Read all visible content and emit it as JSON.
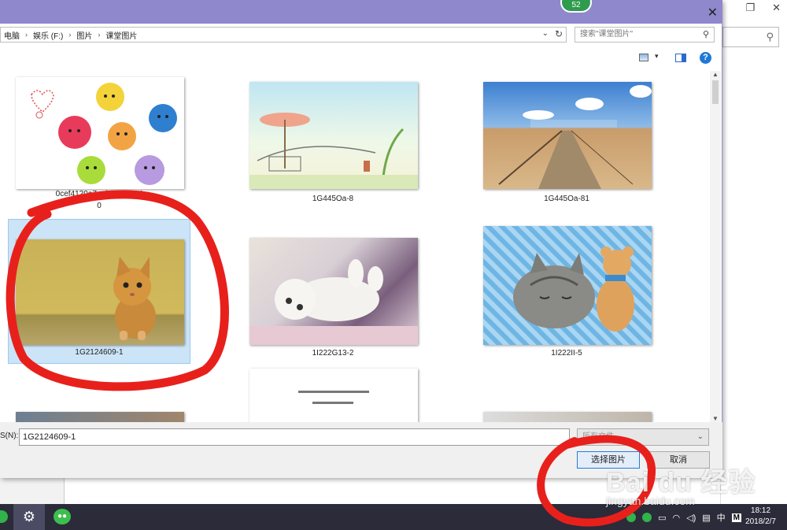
{
  "dialog": {
    "badge": "52",
    "close_glyph": "✕",
    "address": {
      "crumbs": [
        "电脑",
        "娱乐 (F:)",
        "图片",
        "课堂图片"
      ],
      "separator": "›",
      "dropdown_glyph": "⌄",
      "refresh_glyph": "↻"
    },
    "search": {
      "placeholder": "搜索\"课堂图片\"",
      "icon": "search-icon"
    },
    "help_glyph": "?",
    "view_glyph": "▾",
    "items": [
      {
        "caption": "0cef4120a7...d1_522_34",
        "caption2": "0",
        "picture": "blob-characters",
        "selected": false
      },
      {
        "caption": "1G445Oa-8",
        "picture": "garden-pavilion",
        "selected": false
      },
      {
        "caption": "1G445Oa-81",
        "picture": "beach-boardwalk",
        "selected": false
      },
      {
        "caption": "1G2124609-1",
        "picture": "orange-kitten",
        "selected": true
      },
      {
        "caption": "1I222G13-2",
        "picture": "white-kitten",
        "selected": false
      },
      {
        "caption": "1I222II-5",
        "picture": "sleeping-cat-teddy",
        "selected": false
      }
    ],
    "filename": {
      "label": "S(N):",
      "value": "1G2124609-1"
    },
    "filetype": {
      "value": "所有文件"
    },
    "buttons": {
      "ok": "选择图片",
      "cancel": "取消"
    },
    "scroll": {
      "up": "▲",
      "down": "▼"
    }
  },
  "background_window": {
    "restore_glyph": "❐",
    "close_glyph": "✕"
  },
  "taskbar": {
    "tray": {
      "caret": "^",
      "ime": "中",
      "ime_mode": "M"
    },
    "clock": {
      "time": "18:12",
      "date": "2018/2/7"
    }
  },
  "watermark": {
    "brand": "Bai du 经验",
    "url": "jingyan.baidu.com"
  },
  "colors": {
    "titlebar": "#8f88cc",
    "selection": "#cce4f7",
    "annotation": "#e8201c"
  }
}
